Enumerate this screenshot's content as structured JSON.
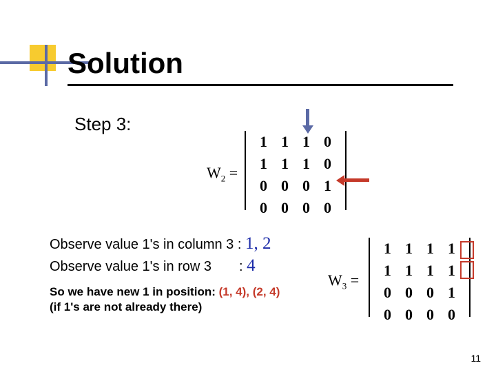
{
  "title": "Solution",
  "step_label": "Step 3:",
  "w2": {
    "label": "W",
    "sub": "2",
    "eq": " ="
  },
  "w3": {
    "label": "W",
    "sub": "3",
    "eq": " ="
  },
  "m2": [
    [
      "1",
      "1",
      "1",
      "0"
    ],
    [
      "1",
      "1",
      "1",
      "0"
    ],
    [
      "0",
      "0",
      "0",
      "1"
    ],
    [
      "0",
      "0",
      "0",
      "0"
    ]
  ],
  "m3": [
    [
      "1",
      "1",
      "1",
      "1"
    ],
    [
      "1",
      "1",
      "1",
      "1"
    ],
    [
      "0",
      "0",
      "0",
      "1"
    ],
    [
      "0",
      "0",
      "0",
      "0"
    ]
  ],
  "obs1": {
    "prefix": "Observe value 1's in column 3 : ",
    "val": "1, 2"
  },
  "obs2": {
    "prefix": "Observe value 1's in row 3",
    "colon": ": ",
    "val": "4"
  },
  "conc": {
    "line1_a": "So we have new 1 in position: ",
    "line1_b": "(1, 4), (2, 4)",
    "line2": "(if 1's are not already there)"
  },
  "page": "11",
  "arrows": {
    "down": "column-3-arrow",
    "left": "row-3-arrow"
  }
}
